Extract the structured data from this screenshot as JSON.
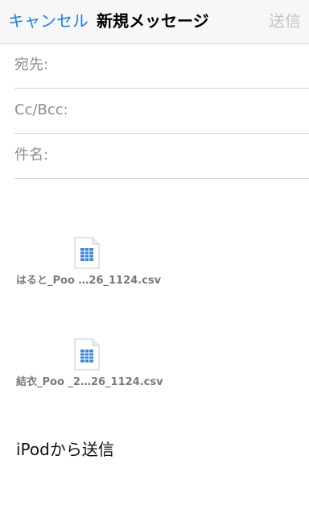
{
  "navbar": {
    "cancel_label": "キャンセル",
    "title": "新規メッセージ",
    "send_label": "送信"
  },
  "fields": {
    "to_label": "宛先:",
    "cc_bcc_label": "Cc/Bcc:",
    "subject_label": "件名:"
  },
  "attachments": [
    {
      "name": "はると_Poo …26_1124.csv",
      "icon": "spreadsheet-file-icon"
    },
    {
      "name": "結衣_Poo _2…26_1124.csv",
      "icon": "spreadsheet-file-icon"
    }
  ],
  "body": {
    "signature": "iPodから送信"
  },
  "colors": {
    "accent": "#1a7cf5",
    "disabled": "#c4c4c4",
    "label": "#8e8e93",
    "file_blue": "#3a86d8"
  }
}
